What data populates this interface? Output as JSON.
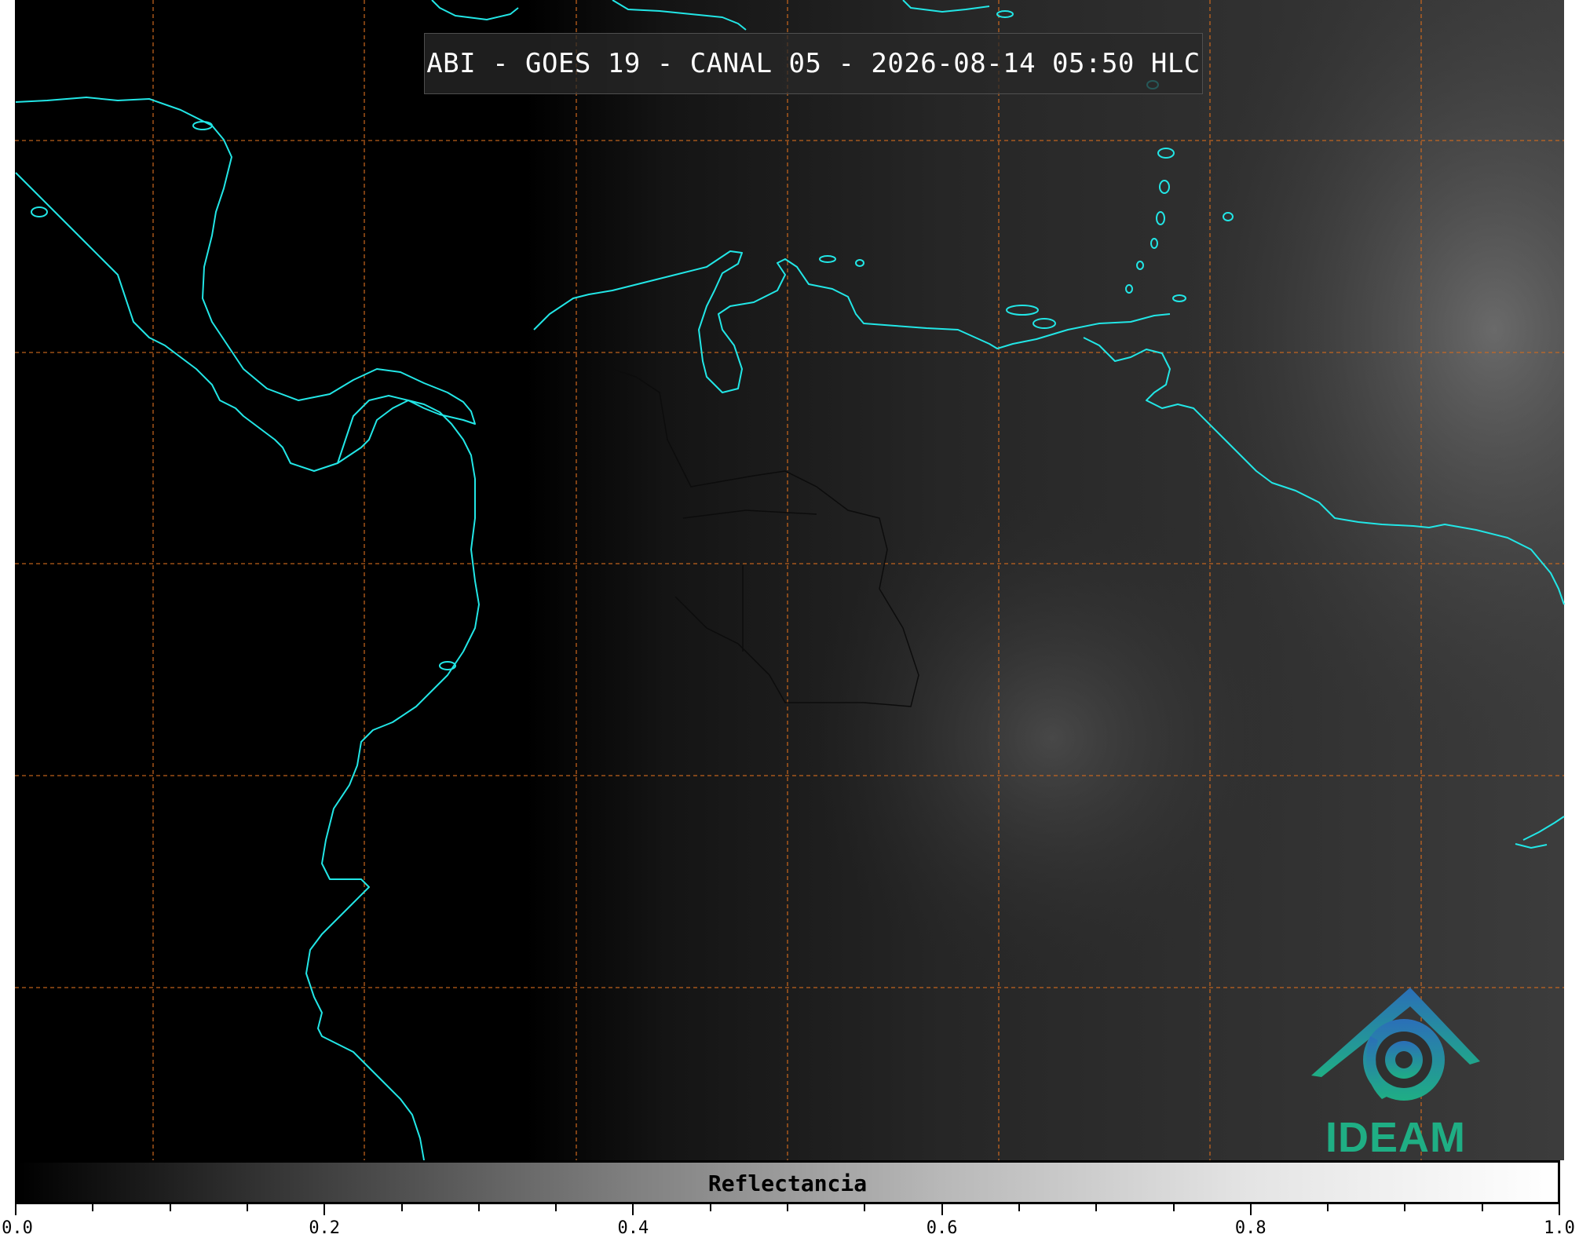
{
  "title": "ABI - GOES 19 - CANAL 05 - 2026-08-14 05:50 HLC",
  "colorbar": {
    "label": "Reflectancia",
    "range": [
      0.0,
      1.0
    ],
    "ticks": [
      "0.0",
      "0.2",
      "0.4",
      "0.6",
      "0.8",
      "1.0"
    ],
    "minor_per_major": 4,
    "colormap": "greys"
  },
  "logo": {
    "text": "IDEAM",
    "colors": {
      "top": "#2b6fb8",
      "bottom": "#1fae84"
    }
  },
  "map": {
    "coastline_color": "#22e6e6",
    "gridline_color": "#d26a1e",
    "gridline_style": "dashed",
    "grid_columns": 8,
    "grid_rows": 5,
    "background_night": "#000000",
    "background_day": "#3a3a3a"
  }
}
